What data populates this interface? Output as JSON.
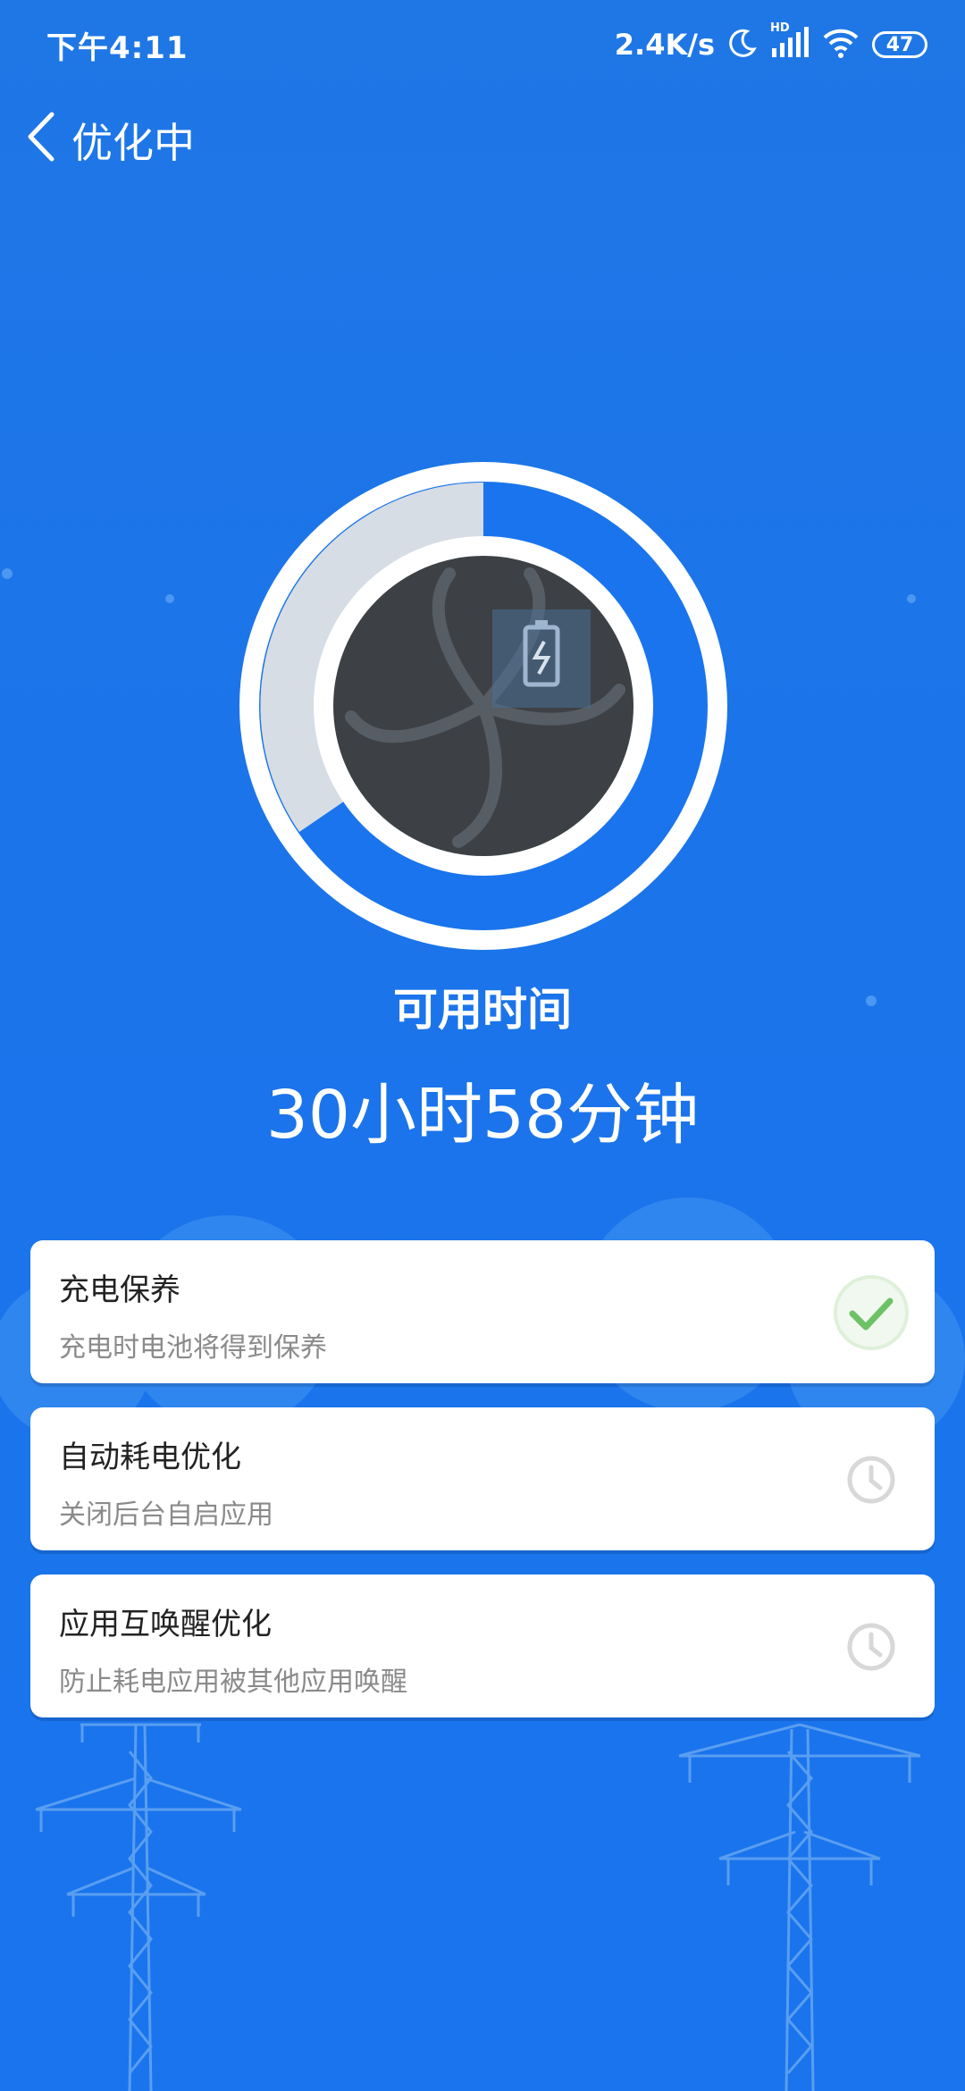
{
  "status_bar": {
    "time": "下午4:11",
    "net_speed": "2.4K/s",
    "hd_label": "HD",
    "battery": "47"
  },
  "header": {
    "title": "优化中"
  },
  "gauge": {
    "label": "可用时间",
    "value": "30小时58分钟"
  },
  "cards": [
    {
      "title": "充电保养",
      "subtitle": "充电时电池将得到保养",
      "status": "done"
    },
    {
      "title": "自动耗电优化",
      "subtitle": "关闭后台自启应用",
      "status": "pending"
    },
    {
      "title": "应用互唤醒优化",
      "subtitle": "防止耗电应用被其他应用唤醒",
      "status": "pending"
    }
  ],
  "colors": {
    "background": "#1a74ee",
    "gauge_fill": "#d6dde4",
    "check": "#6cc265",
    "pending_icon": "#d8d8d8"
  }
}
